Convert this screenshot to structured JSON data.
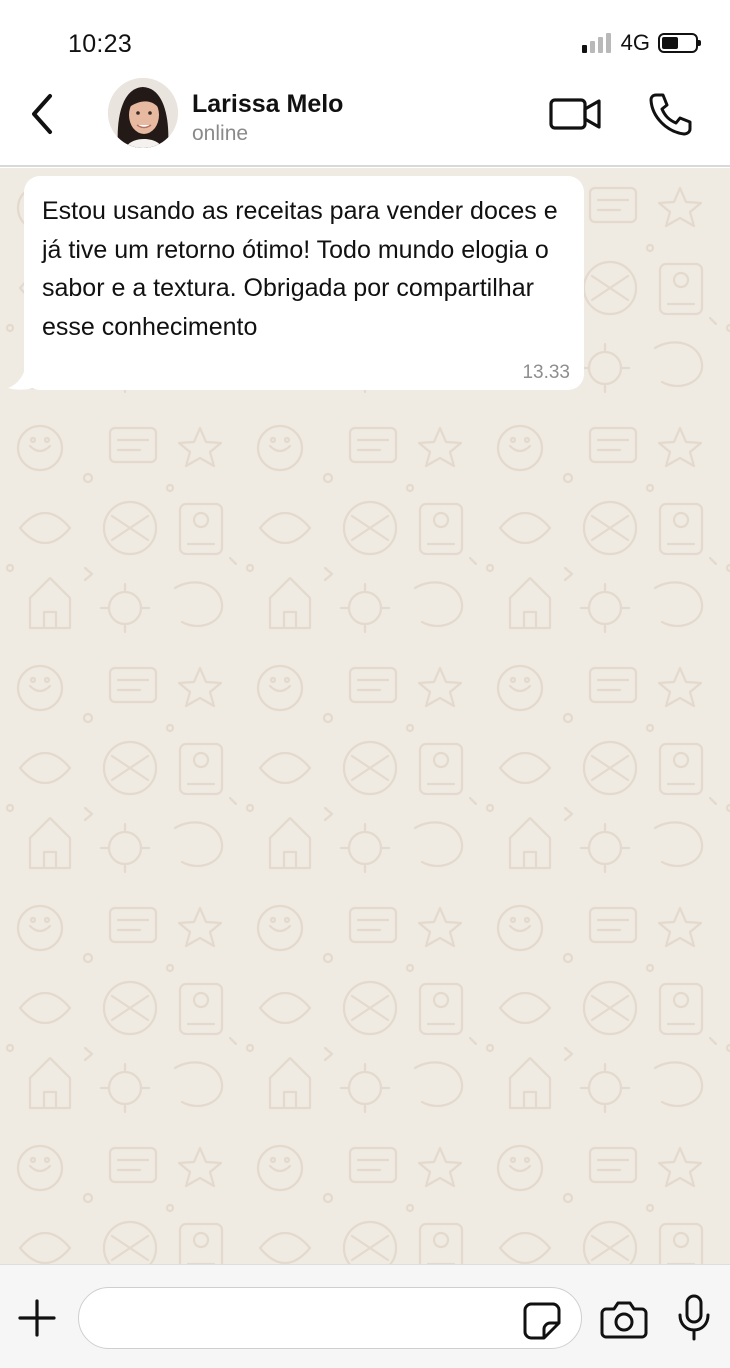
{
  "status_bar": {
    "time": "10:23",
    "network": "4G",
    "signal_bars": 4,
    "signal_bars_active": 1,
    "battery_level": 0.5
  },
  "header": {
    "contact_name": "Larissa Melo",
    "contact_status": "online",
    "icons": {
      "back": "chevron-left-icon",
      "video": "video-camera-icon",
      "call": "phone-icon"
    }
  },
  "messages": [
    {
      "direction": "incoming",
      "text": "Estou usando as receitas para vender doces e já tive um retorno ótimo! Todo mundo elogia o sabor e a textura. Obrigada por compartilhar esse conhecimento",
      "time": "13.33"
    }
  ],
  "input_bar": {
    "value": "",
    "icons": {
      "attach": "plus-icon",
      "sticker": "sticker-icon",
      "camera": "camera-icon",
      "mic": "microphone-icon"
    }
  },
  "colors": {
    "chat_background": "#efeae2",
    "wallpaper_doodle": "#e3d9cd",
    "bubble": "#ffffff",
    "header_background": "#ffffff",
    "input_bar_background": "#f6f6f6"
  }
}
